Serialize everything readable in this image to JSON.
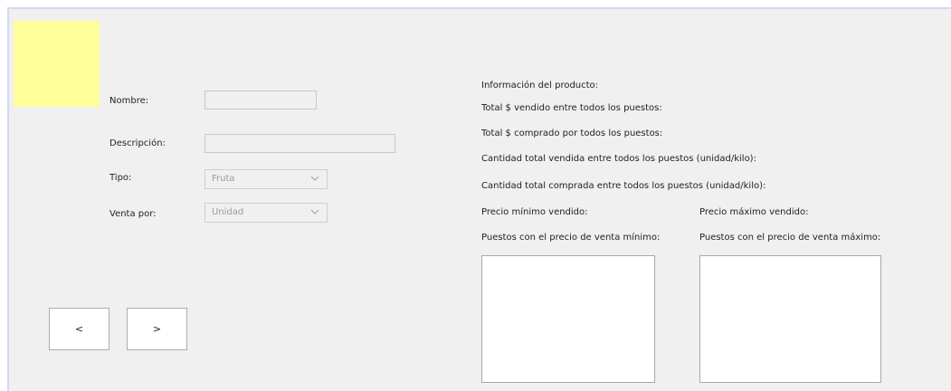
{
  "form": {
    "image_color": "#ffff99",
    "nombre_label": "Nombre:",
    "nombre_value": "",
    "descripcion_label": "Descripción:",
    "descripcion_value": "",
    "tipo_label": "Tipo:",
    "tipo_value": "Fruta",
    "venta_label": "Venta por:",
    "venta_value": "Unidad"
  },
  "nav": {
    "prev_label": "<",
    "next_label": ">"
  },
  "info": {
    "title": "Información del producto:",
    "total_vendido": "Total $ vendido entre todos los puestos:",
    "total_comprado": "Total $ comprado por todos los puestos:",
    "cantidad_vendida": "Cantidad total vendida entre todos los puestos (unidad/kilo):",
    "cantidad_comprada": "Cantidad total comprada entre todos los puestos (unidad/kilo):",
    "precio_minimo": "Precio mínimo vendido:",
    "precio_maximo": "Precio máximo vendido:",
    "puestos_minimo": "Puestos con el precio de venta  mínimo:",
    "puestos_maximo": "Puestos con el precio de venta máximo:",
    "puestos_minimo_items": [],
    "puestos_maximo_items": []
  }
}
